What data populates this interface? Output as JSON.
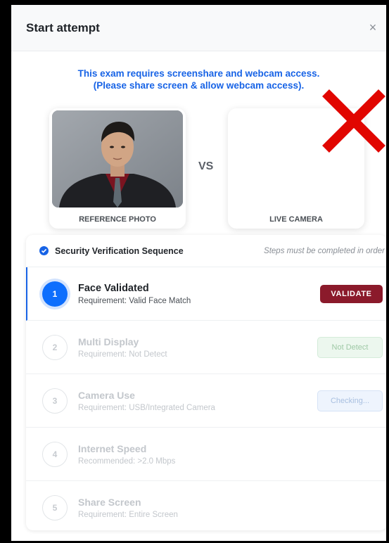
{
  "modal": {
    "title": "Start attempt",
    "close_symbol": "×"
  },
  "notice": {
    "line1": "This exam requires screenshare and webcam access.",
    "line2": "(Please share screen & allow webcam access)."
  },
  "compare": {
    "reference_label": "REFERENCE PHOTO",
    "live_label": "LIVE CAMERA",
    "vs": "VS"
  },
  "verification": {
    "title": "Security Verification Sequence",
    "note": "Steps must be completed in order",
    "steps": [
      {
        "num": "1",
        "title": "Face Validated",
        "requirement": "Requirement: Valid Face Match",
        "action": "VALIDATE"
      },
      {
        "num": "2",
        "title": "Multi Display",
        "requirement": "Requirement: Not Detect",
        "action": "Not Detect"
      },
      {
        "num": "3",
        "title": "Camera Use",
        "requirement": "Requirement: USB/Integrated Camera",
        "action": "Checking..."
      },
      {
        "num": "4",
        "title": "Internet Speed",
        "requirement": "Recommended: >2.0 Mbps"
      },
      {
        "num": "5",
        "title": "Share Screen",
        "requirement": "Requirement: Entire Screen"
      }
    ]
  },
  "colors": {
    "accent": "#1763e6",
    "validate_button": "#8b1a2b",
    "error_cross": "#e10600"
  }
}
